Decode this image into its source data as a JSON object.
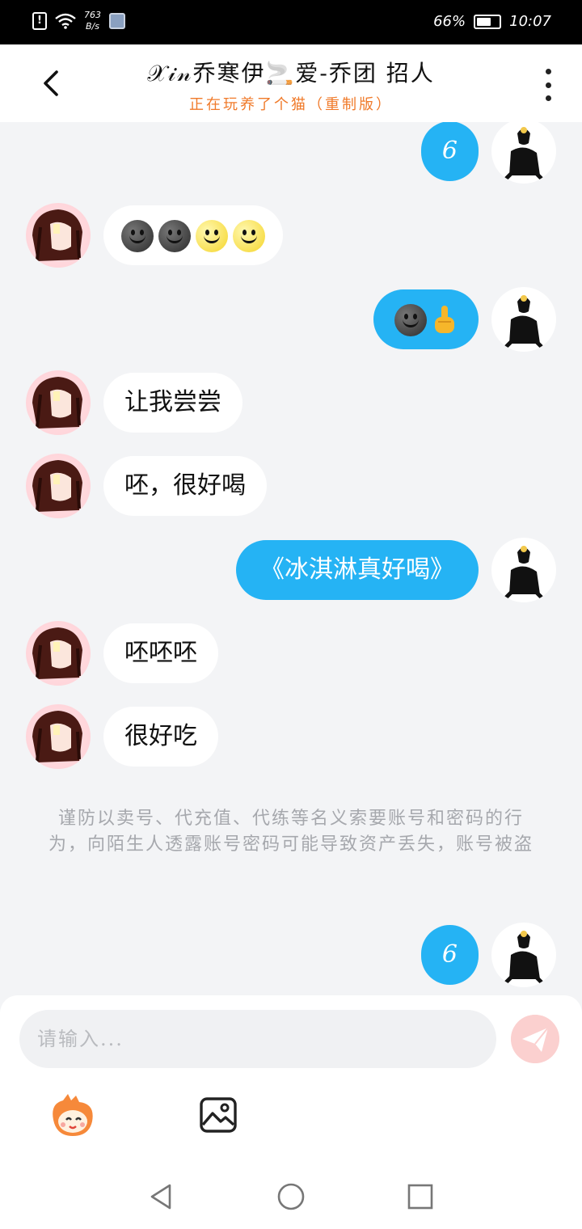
{
  "status_bar": {
    "net_speed_value": "763",
    "net_speed_unit": "B/s",
    "battery_percent": "66%",
    "battery_level": 0.66,
    "time": "10:07"
  },
  "header": {
    "title": "𝒳𝒾𝓃乔寒伊🚬爱-乔团 招人",
    "subtitle": "正在玩养了个猫（重制版）"
  },
  "messages": [
    {
      "side": "right",
      "text": "6"
    },
    {
      "side": "left",
      "text": ""
    },
    {
      "side": "right",
      "text": ""
    },
    {
      "side": "left",
      "text": "让我尝尝"
    },
    {
      "side": "left",
      "text": "呸，很好喝"
    },
    {
      "side": "right",
      "text": "《冰淇淋真好喝》"
    },
    {
      "side": "left",
      "text": "呸呸呸"
    },
    {
      "side": "left",
      "text": "很好吃"
    },
    {
      "side": "right",
      "text": "6"
    }
  ],
  "warning": "谨防以卖号、代充值、代练等名义索要账号和密码的行为，向陌生人透露账号密码可能导致资产丢失，账号被盗",
  "input": {
    "placeholder": "请输入..."
  },
  "colors": {
    "accent_blue": "#25b3f4",
    "subtitle_orange": "#f07a2a",
    "send_button": "#fbd0cf"
  },
  "icons": {
    "back": "chevron-left-icon",
    "menu": "more-vertical-icon",
    "send": "paper-plane-icon",
    "emoji": "cartoon-face-icon",
    "image": "image-icon"
  }
}
